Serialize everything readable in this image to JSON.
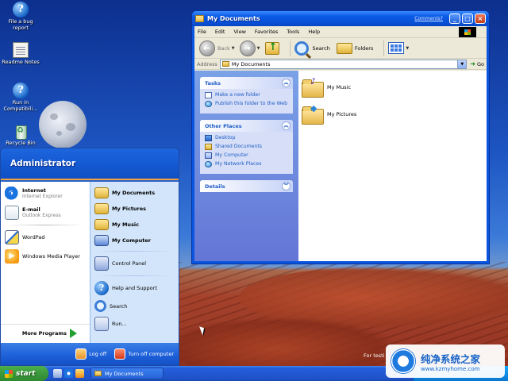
{
  "desktop": {
    "icons": [
      {
        "label": "File a bug report",
        "icon": "help-icon"
      },
      {
        "label": "Readme Notes",
        "icon": "notepad-icon"
      },
      {
        "label": "Run in Compatibili...",
        "icon": "help-icon"
      },
      {
        "label": "Recycle Bin",
        "icon": "recycle-bin-icon"
      }
    ],
    "partial_text": "For testi"
  },
  "explorer": {
    "title": "My Documents",
    "comments_link": "Comments?",
    "menu": [
      "File",
      "Edit",
      "View",
      "Favorites",
      "Tools",
      "Help"
    ],
    "toolbar": {
      "back": "Back",
      "search": "Search",
      "folders": "Folders"
    },
    "address": {
      "label": "Address",
      "value": "My Documents",
      "go": "Go"
    },
    "tasks": {
      "title": "Tasks",
      "items": [
        "Make a new folder",
        "Publish this folder to the Web"
      ]
    },
    "other_places": {
      "title": "Other Places",
      "items": [
        "Desktop",
        "Shared Documents",
        "My Computer",
        "My Network Places"
      ]
    },
    "details": {
      "title": "Details"
    },
    "files": [
      {
        "name": "My Music",
        "icon": "music-folder-icon"
      },
      {
        "name": "My Pictures",
        "icon": "pictures-folder-icon"
      }
    ]
  },
  "start_menu": {
    "user": "Administrator",
    "pinned": [
      {
        "main": "Internet",
        "sub": "Internet Explorer"
      },
      {
        "main": "E-mail",
        "sub": "Outlook Express"
      }
    ],
    "recent": [
      "WordPad",
      "Windows Media Player"
    ],
    "more_programs": "More Programs",
    "places": [
      "My Documents",
      "My Pictures",
      "My Music",
      "My Computer"
    ],
    "control_panel": "Control Panel",
    "support": [
      "Help and Support",
      "Search",
      "Run..."
    ],
    "log_off": "Log off",
    "turn_off": "Turn off computer"
  },
  "taskbar": {
    "start": "start",
    "task_button": "My Documents"
  },
  "watermark": {
    "name": "纯净系统之家",
    "url": "www.kzmyhome.com"
  },
  "colors": {
    "xp_blue": "#0a55e0",
    "task_pane": "#6375d6",
    "start_green": "#3c983c",
    "link_blue": "#215dc6"
  }
}
